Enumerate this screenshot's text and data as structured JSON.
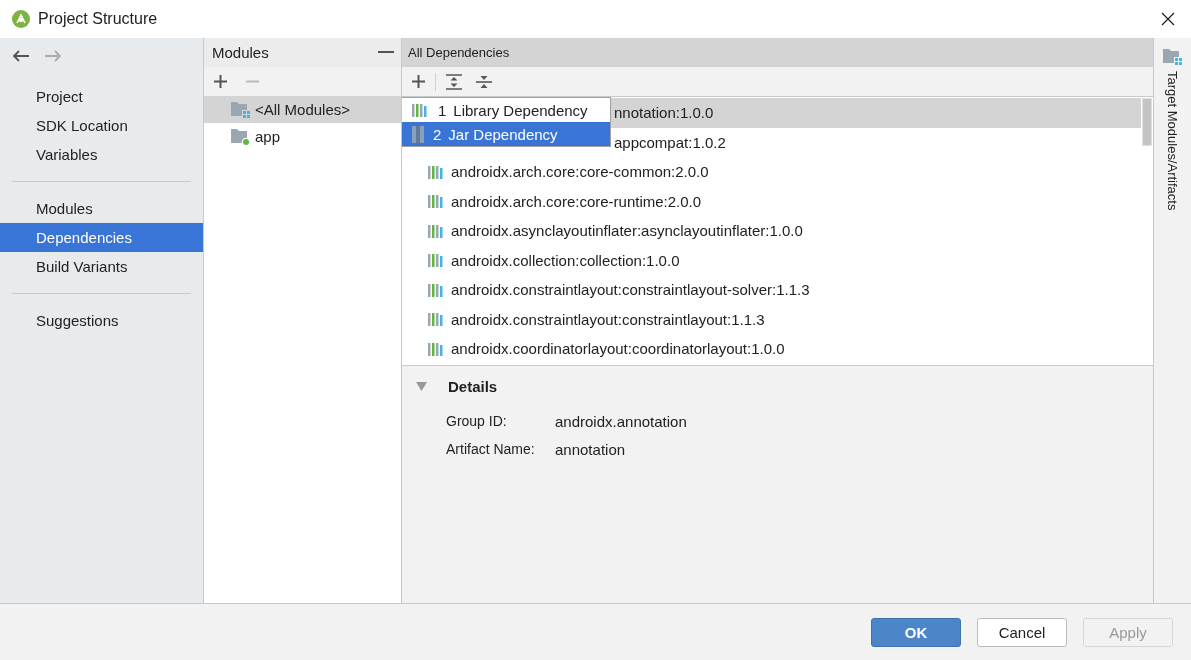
{
  "window": {
    "title": "Project Structure"
  },
  "sidebar": {
    "sections": [
      {
        "items": [
          {
            "label": "Project",
            "selected": false
          },
          {
            "label": "SDK Location",
            "selected": false
          },
          {
            "label": "Variables",
            "selected": false
          }
        ]
      },
      {
        "items": [
          {
            "label": "Modules",
            "selected": false
          },
          {
            "label": "Dependencies",
            "selected": true
          },
          {
            "label": "Build Variants",
            "selected": false
          }
        ]
      },
      {
        "items": [
          {
            "label": "Suggestions",
            "selected": false
          }
        ]
      }
    ]
  },
  "modules": {
    "title": "Modules",
    "items": [
      {
        "label": "<All Modules>",
        "selected": true,
        "kind": "all"
      },
      {
        "label": "app",
        "selected": false,
        "kind": "module"
      }
    ]
  },
  "dependencies": {
    "title": "All Dependencies",
    "rows": [
      {
        "label": "nnotation:1.0.0",
        "selected": true,
        "kind": "covered"
      },
      {
        "label": "appcompat:1.0.2",
        "selected": false,
        "kind": "covered"
      },
      {
        "label": "androidx.arch.core:core-common:2.0.0",
        "selected": false,
        "kind": "library"
      },
      {
        "label": "androidx.arch.core:core-runtime:2.0.0",
        "selected": false,
        "kind": "library"
      },
      {
        "label": "androidx.asynclayoutinflater:asynclayoutinflater:1.0.0",
        "selected": false,
        "kind": "library"
      },
      {
        "label": "androidx.collection:collection:1.0.0",
        "selected": false,
        "kind": "library"
      },
      {
        "label": "androidx.constraintlayout:constraintlayout-solver:1.1.3",
        "selected": false,
        "kind": "library"
      },
      {
        "label": "androidx.constraintlayout:constraintlayout:1.1.3",
        "selected": false,
        "kind": "library"
      },
      {
        "label": "androidx.coordinatorlayout:coordinatorlayout:1.0.0",
        "selected": false,
        "kind": "library"
      }
    ]
  },
  "popup_menu": {
    "items": [
      {
        "number": "1",
        "label": "Library Dependency",
        "selected": false,
        "kind": "library"
      },
      {
        "number": "2",
        "label": "Jar Dependency",
        "selected": true,
        "kind": "jar"
      }
    ]
  },
  "details": {
    "title": "Details",
    "expanded": true,
    "fields": [
      {
        "label": "Group ID:",
        "value": "androidx.annotation"
      },
      {
        "label": "Artifact Name:",
        "value": "annotation"
      }
    ]
  },
  "side_tab": {
    "label": "Target Modules/Artifacts"
  },
  "buttons": [
    {
      "label": "OK",
      "kind": "primary",
      "disabled": false
    },
    {
      "label": "Cancel",
      "kind": "normal",
      "disabled": false
    },
    {
      "label": "Apply",
      "kind": "normal",
      "disabled": true
    }
  ]
}
